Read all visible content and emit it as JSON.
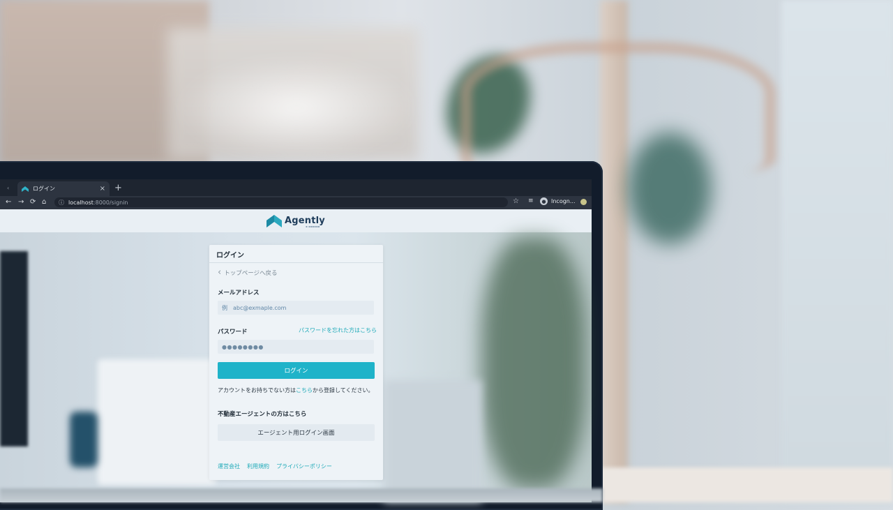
{
  "browser": {
    "tab": {
      "title": "ログイン",
      "close": "×",
      "new": "+"
    },
    "nav": {
      "back": "←",
      "forward": "→",
      "reload": "⟳",
      "home": "⌂"
    },
    "url": {
      "host": "localhost",
      "rest": ":8000/signin"
    },
    "star": "☆",
    "profile": {
      "label": "Incogn..."
    }
  },
  "site": {
    "brand": "Agently",
    "brand_sub": "▪ ▪▪▪▪▪▪"
  },
  "login": {
    "title": "ログイン",
    "back_link": "トップページへ戻る",
    "email_label": "メールアドレス",
    "email_placeholder": "例　abc@exmaple.com",
    "password_label": "パスワード",
    "forgot_link": "パスワードを忘れた方はこちら",
    "password_value": "●●●●●●●●",
    "submit": "ログイン",
    "register_prefix": "アカウントをお持ちでない方は",
    "register_link": "こちら",
    "register_suffix": "から登録してください。",
    "agent_heading": "不動産エージェントの方はこちら",
    "agent_button": "エージェント用ログイン画面",
    "footer": [
      "運営会社",
      "利用規約",
      "プライバシーポリシー"
    ]
  },
  "colors": {
    "accent": "#1fb3c9",
    "link": "#1eaab8",
    "brand_navy": "#1f3d5b"
  }
}
